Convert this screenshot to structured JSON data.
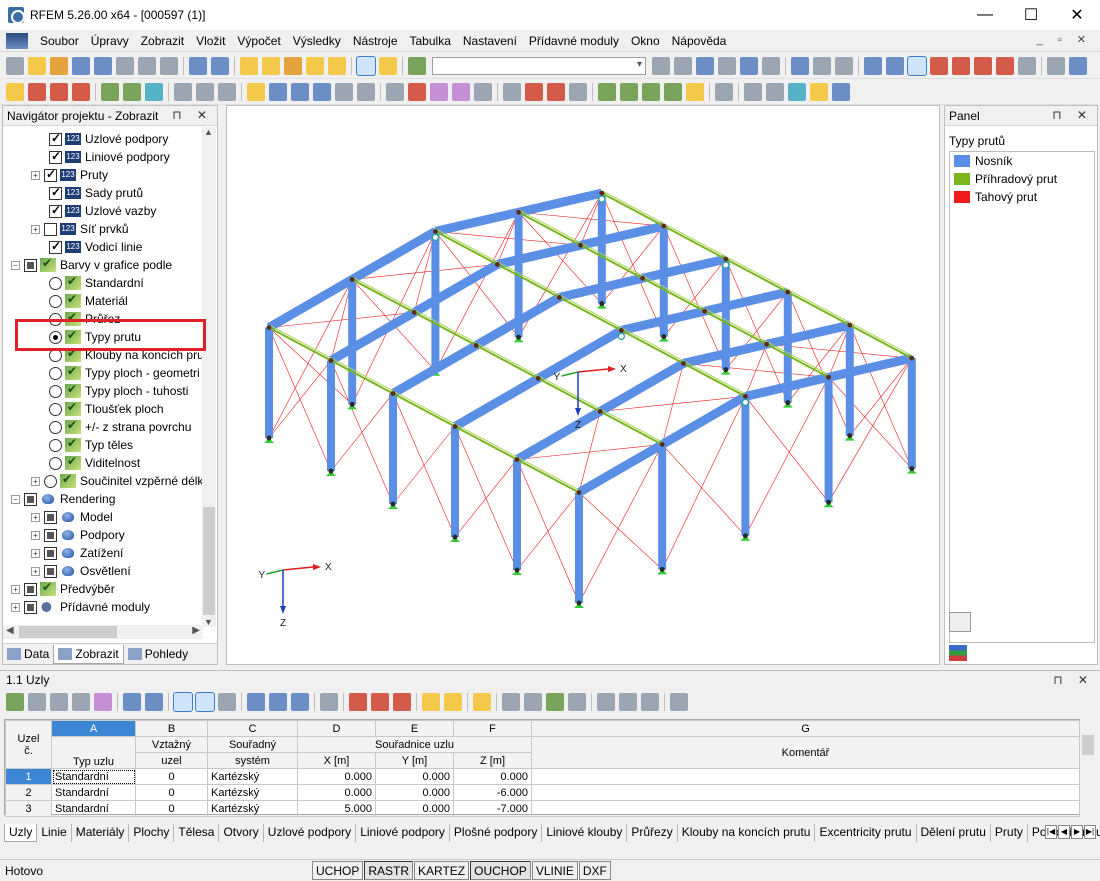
{
  "window": {
    "title": "RFEM 5.26.00 x64 - [000597 (1)]",
    "minimize": "—",
    "maximize": "☐",
    "close": "✕"
  },
  "menu": [
    "Soubor",
    "Úpravy",
    "Zobrazit",
    "Vložit",
    "Výpočet",
    "Výsledky",
    "Nástroje",
    "Tabulka",
    "Nastavení",
    "Přídavné moduly",
    "Okno",
    "Nápověda"
  ],
  "navigator": {
    "title": "Navigátor projektu - Zobrazit",
    "items": [
      {
        "label": "Uzlové podpory",
        "type": "check",
        "checked": true,
        "icon": "numbers-icon"
      },
      {
        "label": "Liniové podpory",
        "type": "check",
        "checked": true,
        "icon": "numbers-icon"
      },
      {
        "label": "Pruty",
        "type": "check",
        "checked": true,
        "icon": "numbers-icon"
      },
      {
        "label": "Sady prutů",
        "type": "check",
        "checked": true,
        "icon": "numbers-icon"
      },
      {
        "label": "Uzlové vazby",
        "type": "check",
        "checked": true,
        "icon": "numbers-icon"
      },
      {
        "label": "Síť prvků",
        "type": "check",
        "checked": false,
        "icon": "numbers-icon"
      },
      {
        "label": "Vodicí linie",
        "type": "check",
        "checked": true,
        "icon": "numbers-icon"
      },
      {
        "label": "Barvy v grafice podle",
        "type": "group",
        "icon": "color-check-icon"
      },
      {
        "label": "Standardní",
        "type": "radio",
        "checked": false,
        "icon": "color-check-icon"
      },
      {
        "label": "Materiál",
        "type": "radio",
        "checked": false,
        "icon": "color-check-icon"
      },
      {
        "label": "Průřez",
        "type": "radio",
        "checked": false,
        "icon": "color-check-icon"
      },
      {
        "label": "Typy prutu",
        "type": "radio",
        "checked": true,
        "icon": "color-check-icon"
      },
      {
        "label": "Klouby na koncích prut",
        "type": "radio",
        "checked": false,
        "icon": "color-check-icon"
      },
      {
        "label": "Typy ploch - geometri",
        "type": "radio",
        "checked": false,
        "icon": "color-check-icon"
      },
      {
        "label": "Typy ploch - tuhosti",
        "type": "radio",
        "checked": false,
        "icon": "color-check-icon"
      },
      {
        "label": "Tloušťek ploch",
        "type": "radio",
        "checked": false,
        "icon": "color-check-icon"
      },
      {
        "label": "+/- z strana povrchu",
        "type": "radio",
        "checked": false,
        "icon": "color-check-icon"
      },
      {
        "label": "Typ těles",
        "type": "radio",
        "checked": false,
        "icon": "color-check-icon"
      },
      {
        "label": "Viditelnost",
        "type": "radio",
        "checked": false,
        "icon": "color-check-icon"
      },
      {
        "label": "Součinitel vzpěrné délk",
        "type": "radio",
        "checked": false,
        "icon": "color-check-icon"
      },
      {
        "label": "Rendering",
        "type": "group",
        "icon": "teapot-icon"
      },
      {
        "label": "Model",
        "type": "sub",
        "icon": "teapot-icon"
      },
      {
        "label": "Podpory",
        "type": "sub",
        "icon": "teapot-icon"
      },
      {
        "label": "Zatížení",
        "type": "sub",
        "icon": "teapot-icon"
      },
      {
        "label": "Osvětlení",
        "type": "sub",
        "icon": "teapot-icon"
      },
      {
        "label": "Předvýběr",
        "type": "group",
        "icon": "color-check-icon"
      },
      {
        "label": "Přídavné moduly",
        "type": "group",
        "icon": "addon-icon"
      }
    ],
    "tabs": [
      "Data",
      "Zobrazit",
      "Pohledy"
    ]
  },
  "viewport": {
    "axis_labels": {
      "x": "X",
      "y": "Y",
      "z": "Z"
    }
  },
  "panel": {
    "title": "Panel",
    "subtitle": "Typy prutů",
    "legend": [
      {
        "label": "Nosník",
        "color": "#5b8fe6"
      },
      {
        "label": "Příhradový prut",
        "color": "#7ab51d"
      },
      {
        "label": "Tahový prut",
        "color": "#ee1c1c"
      }
    ]
  },
  "table": {
    "title": "1.1 Uzly",
    "col_letters": [
      "A",
      "B",
      "C",
      "D",
      "E",
      "F",
      "G"
    ],
    "head": {
      "node_no": "Uzel č.",
      "node_no_1": "Uzel",
      "node_no_2": "č.",
      "type": "Typ uzlu",
      "ref_1": "Vztažný",
      "ref_2": "uzel",
      "sys_1": "Souřadný",
      "sys_2": "systém",
      "coords": "Souřadnice uzlu",
      "x": "X [m]",
      "y": "Y [m]",
      "z": "Z [m]",
      "comment": "Komentář"
    },
    "rows": [
      {
        "no": "1",
        "type": "Standardní",
        "ref": "0",
        "sys": "Kartézský",
        "x": "0.000",
        "y": "0.000",
        "z": "0.000",
        "comment": ""
      },
      {
        "no": "2",
        "type": "Standardní",
        "ref": "0",
        "sys": "Kartézský",
        "x": "0.000",
        "y": "0.000",
        "z": "-6.000",
        "comment": ""
      },
      {
        "no": "3",
        "type": "Standardní",
        "ref": "0",
        "sys": "Kartézský",
        "x": "5.000",
        "y": "0.000",
        "z": "-7.000",
        "comment": ""
      }
    ],
    "tabs": [
      "Uzly",
      "Linie",
      "Materiály",
      "Plochy",
      "Tělesa",
      "Otvory",
      "Uzlové podpory",
      "Liniové podpory",
      "Plošné podpory",
      "Liniové klouby",
      "Průřezy",
      "Klouby na koncích prutu",
      "Excentricity prutu",
      "Dělení prutu",
      "Pruty",
      "Podloží prutu"
    ]
  },
  "status": {
    "text": "Hotovo",
    "buttons": [
      {
        "label": "UCHOP",
        "on": false
      },
      {
        "label": "RASTR",
        "on": true
      },
      {
        "label": "KARTEZ",
        "on": false
      },
      {
        "label": "OUCHOP",
        "on": true
      },
      {
        "label": "VLINIE",
        "on": false
      },
      {
        "label": "DXF",
        "on": false
      }
    ]
  }
}
